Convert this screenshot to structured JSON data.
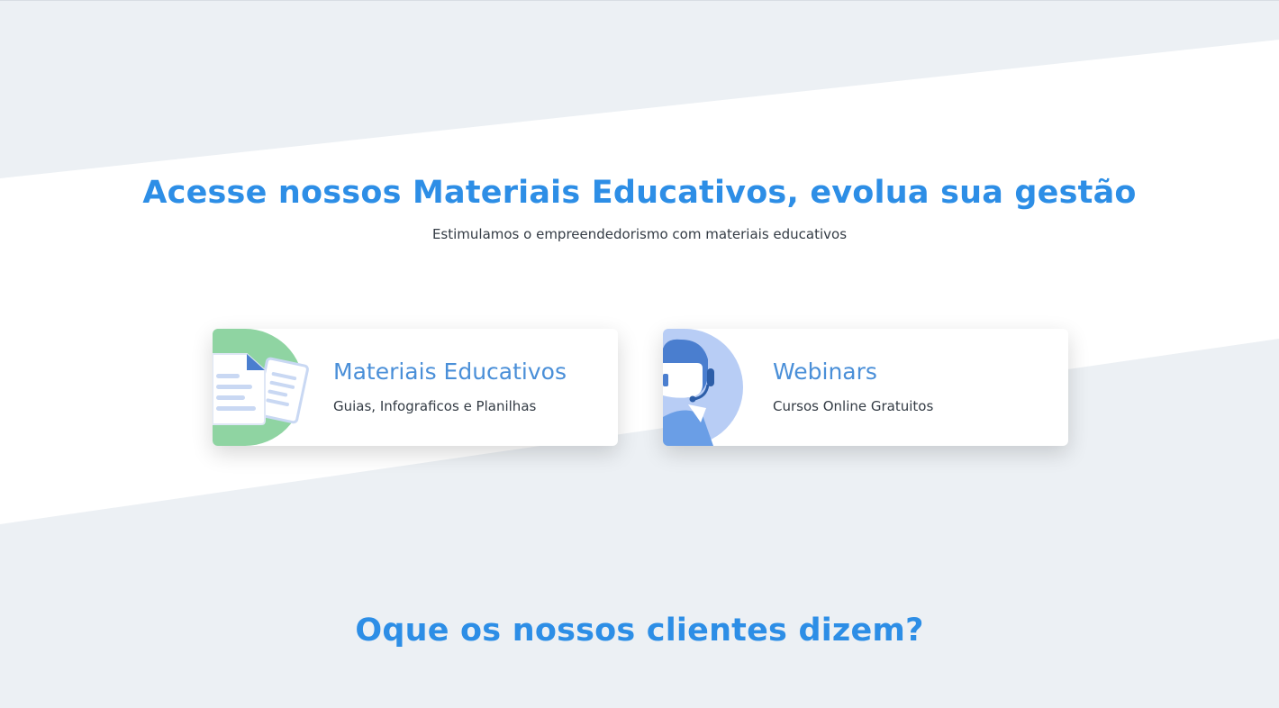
{
  "education": {
    "title": "Acesse nossos Materiais Educativos, evolua sua gestão",
    "subtitle": "Estimulamos o empreendedorismo com materiais educativos"
  },
  "cards": [
    {
      "title": "Materiais Educativos",
      "description": "Guias, Infograficos e Planilhas",
      "icon": "documents-icon",
      "accent": "#8fd4a2"
    },
    {
      "title": "Webinars",
      "description": "Cursos Online Gratuitos",
      "icon": "support-agent-icon",
      "accent": "#b8cdf5"
    }
  ],
  "testimonials": {
    "title": "Oque os nossos clientes dizem?"
  },
  "colors": {
    "heading": "#2d8ee6",
    "card_title": "#4a8fd8",
    "band": "#ecf0f4",
    "text": "#333b44"
  }
}
